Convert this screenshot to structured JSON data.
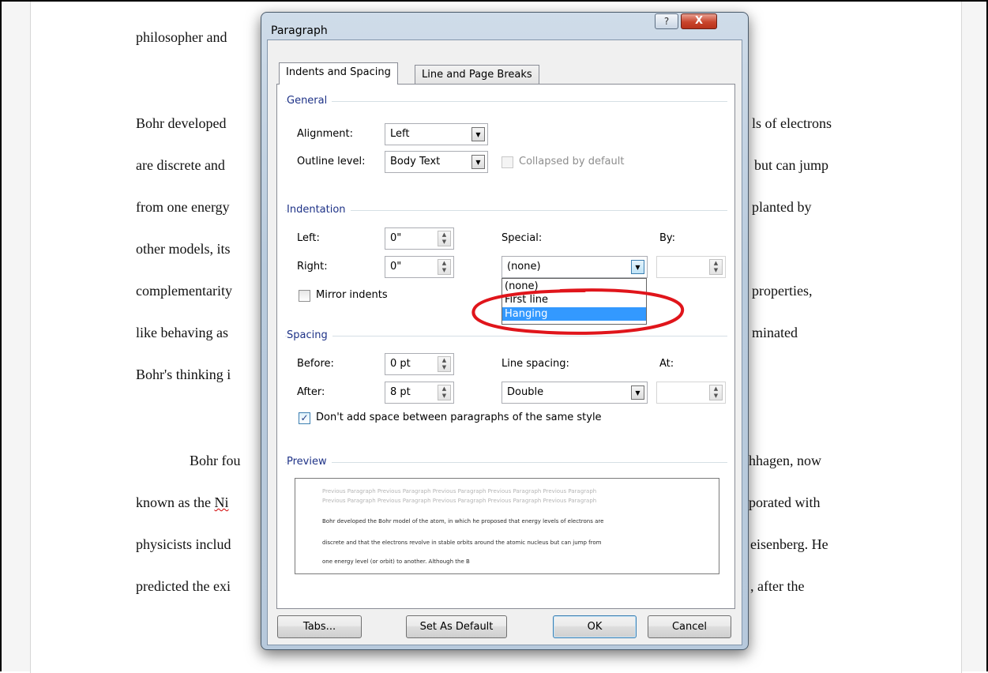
{
  "document": {
    "lines": [
      "philosopher and",
      "Bohr developed",
      "are discrete and",
      "from one energy",
      "other models, its",
      "complementarity",
      "like behaving as",
      "Bohr's thinking i",
      "Bohr fou",
      "known as the",
      "Ni",
      "physicists includ",
      "predicted the exi"
    ],
    "right_lines": [
      "ls of electrons",
      "but can jump",
      "planted by",
      "properties,",
      "minated",
      "hhagen, now",
      "porated with",
      "eisenberg. He",
      ", after the"
    ]
  },
  "dialog": {
    "title": "Paragraph",
    "help_label": "?",
    "close_label": "X",
    "tabs": [
      {
        "label": "Indents and Spacing",
        "active": true
      },
      {
        "label": "Line and Page Breaks",
        "active": false
      }
    ],
    "general": {
      "heading": "General",
      "alignment_label": "Alignment:",
      "alignment_value": "Left",
      "outline_label": "Outline level:",
      "outline_value": "Body Text",
      "collapsed_label": "Collapsed by default"
    },
    "indentation": {
      "heading": "Indentation",
      "left_label": "Left:",
      "left_value": "0\"",
      "right_label": "Right:",
      "right_value": "0\"",
      "special_label": "Special:",
      "special_value": "(none)",
      "by_label": "By:",
      "by_value": "",
      "mirror_label": "Mirror indents",
      "special_options": [
        "(none)",
        "First line",
        "Hanging"
      ],
      "special_highlighted": "Hanging"
    },
    "spacing": {
      "heading": "Spacing",
      "before_label": "Before:",
      "before_value": "0 pt",
      "after_label": "After:",
      "after_value": "8 pt",
      "line_spacing_label": "Line spacing:",
      "line_spacing_value": "Double",
      "at_label": "At:",
      "at_value": "",
      "dont_add_label": "Don't add space between paragraphs of the same style",
      "dont_add_checked": true
    },
    "preview": {
      "heading": "Preview",
      "gray_lines": [
        "Previous Paragraph Previous Paragraph Previous Paragraph Previous Paragraph Previous Paragraph",
        "Previous Paragraph Previous Paragraph Previous Paragraph Previous Paragraph Previous Paragraph"
      ],
      "dark_lines": [
        "Bohr developed the Bohr model of the atom, in which he proposed that energy levels of electrons are",
        "discrete and that the electrons revolve in stable orbits around the atomic nucleus but can jump from",
        "one energy level (or orbit) to another. Although the B"
      ]
    },
    "buttons": {
      "tabs": "Tabs...",
      "set_default": "Set As Default",
      "ok": "OK",
      "cancel": "Cancel"
    }
  },
  "colors": {
    "annotation": "#e0151b",
    "highlight": "#3399ff",
    "group_heading": "#1e3287"
  }
}
